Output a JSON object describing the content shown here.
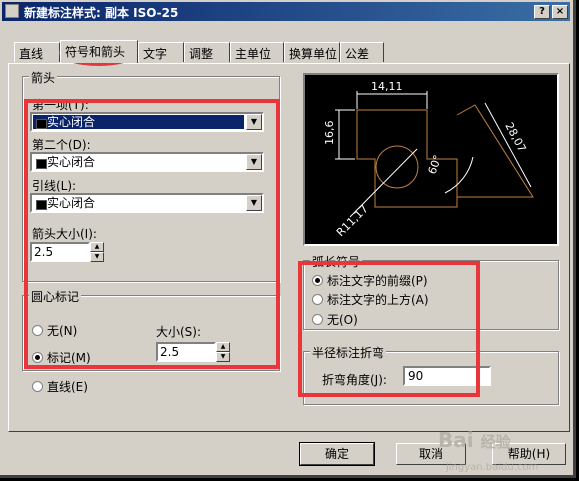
{
  "window": {
    "title": "新建标注样式: 副本 ISO-25",
    "help_btn": "?",
    "close_btn": "×"
  },
  "tabs": [
    "直线",
    "符号和箭头",
    "文字",
    "调整",
    "主单位",
    "换算单位",
    "公差"
  ],
  "arrows": {
    "group_title": "箭头",
    "first_label": "第一项(T):",
    "first_value": "实心闭合",
    "second_label": "第二个(D):",
    "second_value": "实心闭合",
    "leader_label": "引线(L):",
    "leader_value": "实心闭合",
    "size_label": "箭头大小(I):",
    "size_value": "2.5"
  },
  "center_mark": {
    "group_title": "圆心标记",
    "none_label": "无(N)",
    "mark_label": "标记(M)",
    "line_label": "直线(E)",
    "size_label": "大小(S):",
    "size_value": "2.5"
  },
  "preview": {
    "dim_top": "14,11",
    "dim_left": "16,6",
    "dim_right": "28,07",
    "dim_angle": "60°",
    "dim_radius": "R11,17"
  },
  "arc_length": {
    "group_title": "弧长符号",
    "option1": "标注文字的前缀(P)",
    "option2": "标注文字的上方(A)",
    "option3": "无(O)"
  },
  "jog": {
    "group_title": "半径标注折弯",
    "angle_label": "折弯角度(J):",
    "angle_value": "90"
  },
  "buttons": {
    "ok": "确定",
    "cancel": "取消",
    "help": "帮助(H)"
  },
  "watermark": {
    "brand": "Bai",
    "brand2": "经验",
    "url": "jingyan.baidu.com"
  }
}
